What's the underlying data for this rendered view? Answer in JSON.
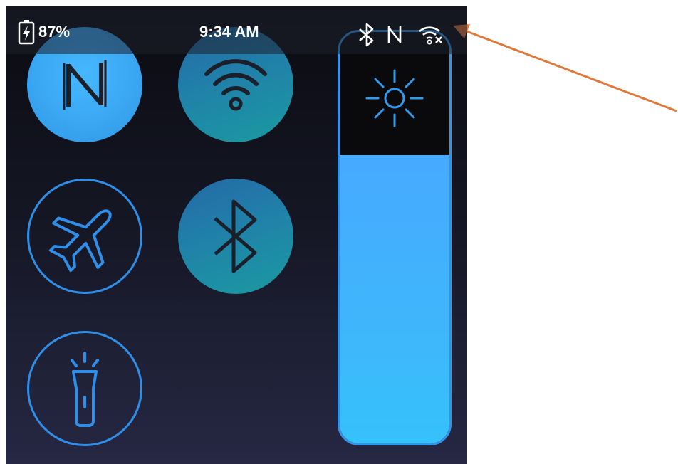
{
  "status_bar": {
    "battery_percent": "87%",
    "time": "9:34 AM",
    "icons": [
      "battery-charging-icon",
      "bluetooth-icon",
      "nfc-icon",
      "wifi-disconnected-icon"
    ]
  },
  "quick_settings": {
    "tiles": [
      {
        "name": "nfc",
        "icon": "nfc-icon",
        "active": true
      },
      {
        "name": "wifi",
        "icon": "wifi-icon",
        "active": true
      },
      {
        "name": "airplane-mode",
        "icon": "airplane-icon",
        "active": false
      },
      {
        "name": "bluetooth",
        "icon": "bluetooth-icon",
        "active": true
      },
      {
        "name": "flashlight",
        "icon": "flashlight-icon",
        "active": false
      }
    ]
  },
  "brightness": {
    "icon": "sun-icon",
    "level": 0.7
  },
  "annotation": {
    "arrow_color": "#e2773a",
    "target": "status-bar-icons"
  },
  "colors": {
    "accent": "#2f8fe8",
    "active_light": "#46b8ff",
    "active_teal": "#1f86a8"
  }
}
